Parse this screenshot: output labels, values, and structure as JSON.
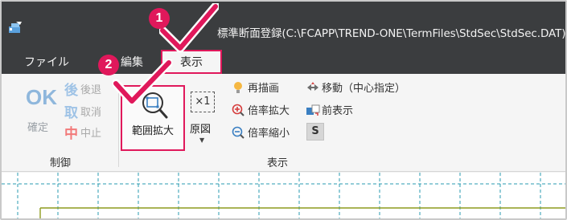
{
  "window": {
    "title": "標準断面登録(C:\\FCAPP\\TREND-ONE\\TermFiles\\StdSec\\StdSec.DAT) -",
    "app_icon": "app-icon"
  },
  "menu": {
    "file": "ファイル",
    "edit": "編集",
    "view": "表示"
  },
  "ribbon": {
    "control_group": {
      "label": "制御",
      "ok_big": "OK",
      "confirm": "確定",
      "back_glyph": "後",
      "back": "後退",
      "cancel_glyph": "取",
      "cancel": "取消",
      "abort_glyph": "中",
      "abort": "中止"
    },
    "view_group": {
      "label": "表示",
      "range_zoom": "範囲拡大",
      "original": "原図",
      "original_icon_text": "×1",
      "redraw": "再描画",
      "zoom_in": "倍率拡大",
      "zoom_out": "倍率縮小",
      "move_center": "移動（中心指定）",
      "previous": "前表示",
      "s_button": "S"
    }
  },
  "callouts": {
    "step1": "1",
    "step2": "2"
  },
  "colors": {
    "accent": "#e0185b",
    "titlebar": "#3b3d3f",
    "grid_cyan": "#2a9bb0"
  }
}
